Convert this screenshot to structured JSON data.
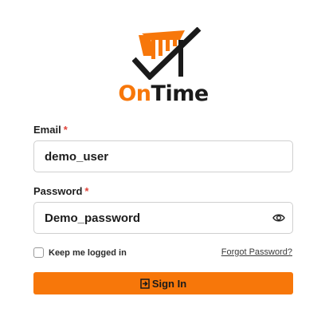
{
  "brand": {
    "name_part1": "On",
    "name_part2": "Time",
    "accent_color": "#f7770a",
    "logo_icon": "checkmark-bars-logo-icon"
  },
  "form": {
    "email": {
      "label": "Email",
      "required_marker": "*",
      "value": "demo_user"
    },
    "password": {
      "label": "Password",
      "required_marker": "*",
      "value": "Demo_password",
      "toggle_icon": "eye-icon"
    },
    "remember": {
      "label": "Keep me logged in",
      "checked": false
    },
    "forgot_link": "Forgot Password?",
    "submit": {
      "label": "Sign In",
      "icon": "sign-in-icon"
    }
  }
}
